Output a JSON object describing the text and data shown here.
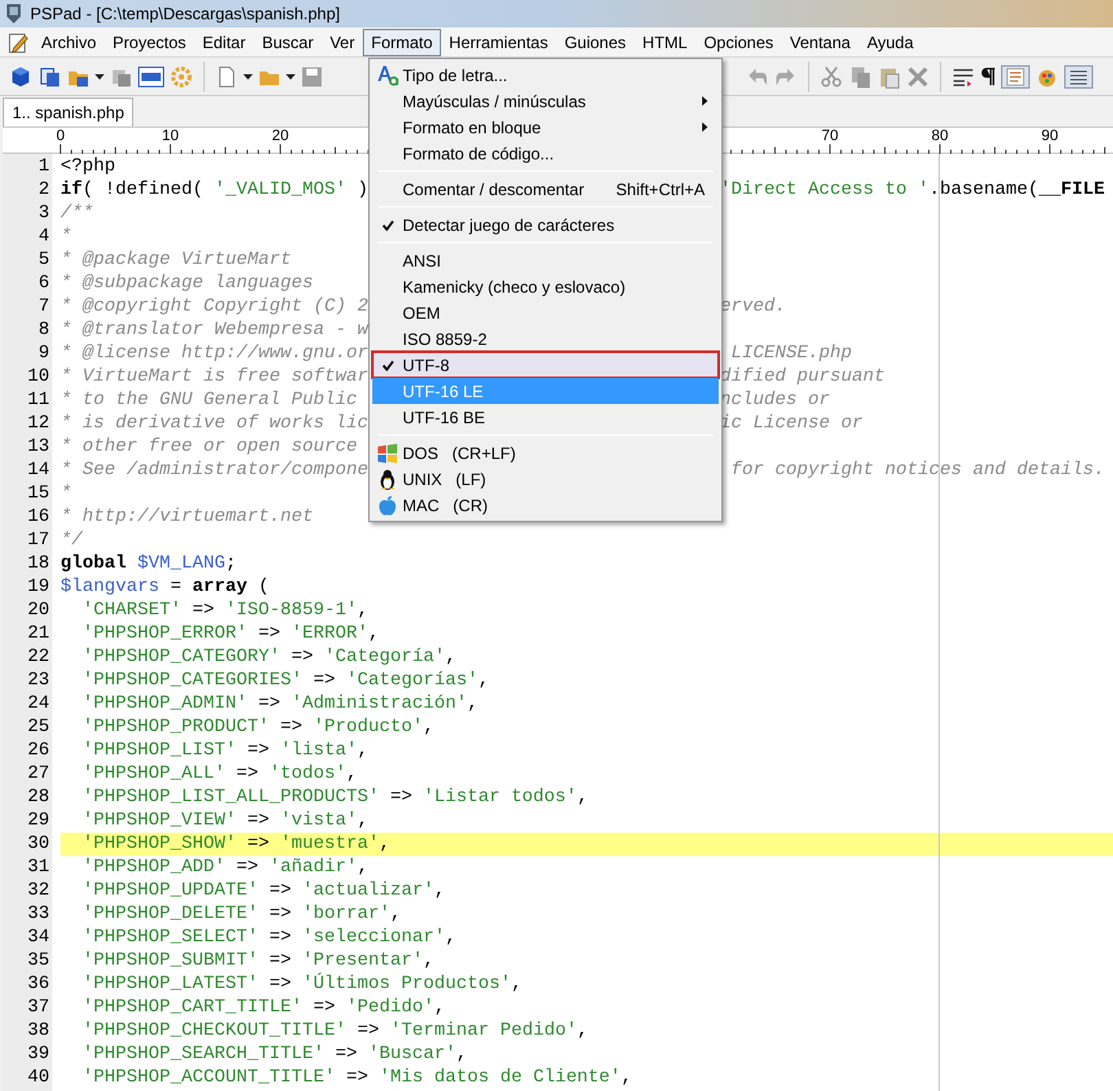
{
  "window": {
    "title": "PSPad - [C:\\temp\\Descargas\\spanish.php]"
  },
  "menu_bar": [
    {
      "label": "Archivo",
      "selected": false
    },
    {
      "label": "Proyectos",
      "selected": false
    },
    {
      "label": "Editar",
      "selected": false
    },
    {
      "label": "Buscar",
      "selected": false
    },
    {
      "label": "Ver",
      "selected": false
    },
    {
      "label": "Formato",
      "selected": true
    },
    {
      "label": "Herramientas",
      "selected": false
    },
    {
      "label": "Guiones",
      "selected": false
    },
    {
      "label": "HTML",
      "selected": false
    },
    {
      "label": "Opciones",
      "selected": false
    },
    {
      "label": "Ventana",
      "selected": false
    },
    {
      "label": "Ayuda",
      "selected": false
    }
  ],
  "tabs": [
    {
      "label": "1.. spanish.php",
      "selected": true
    }
  ],
  "ruler": [
    "0",
    "10",
    "20",
    "70",
    "80",
    "90"
  ],
  "editor": {
    "lines": [
      {
        "number": "1",
        "current": false,
        "tokens": [
          {
            "kind": "plain",
            "text": "<?php"
          }
        ]
      },
      {
        "number": "2",
        "current": false,
        "tokens": [
          {
            "kind": "keyword",
            "text": "if"
          },
          {
            "kind": "plain",
            "text": "( !defined( "
          },
          {
            "kind": "string",
            "text": "'_VALID_MOS'"
          },
          {
            "kind": "plain",
            "text": " )"
          }
        ],
        "tail": [
          {
            "kind": "string",
            "text": "'Direct Access to '"
          },
          {
            "kind": "plain",
            "text": ".basename("
          },
          {
            "kind": "keyword",
            "text": "__FILE"
          }
        ]
      },
      {
        "number": "3",
        "current": false,
        "tokens": [
          {
            "kind": "comment",
            "text": "/**"
          }
        ]
      },
      {
        "number": "4",
        "current": false,
        "tokens": [
          {
            "kind": "comment",
            "text": "*"
          }
        ]
      },
      {
        "number": "5",
        "current": false,
        "tokens": [
          {
            "kind": "comment",
            "text": "* @package VirtueMart"
          }
        ]
      },
      {
        "number": "6",
        "current": false,
        "tokens": [
          {
            "kind": "comment",
            "text": "* @subpackage languages"
          }
        ]
      },
      {
        "number": "7",
        "current": false,
        "tokens": [
          {
            "kind": "comment",
            "text": "* @copyright Copyright (C) 2"
          }
        ],
        "tail": [
          {
            "kind": "comment",
            "text": "erved."
          }
        ]
      },
      {
        "number": "8",
        "current": false,
        "tokens": [
          {
            "kind": "comment",
            "text": "* @translator Webempresa - w"
          }
        ]
      },
      {
        "number": "9",
        "current": false,
        "tokens": [
          {
            "kind": "comment",
            "text": "* @license http://www.gnu.or"
          }
        ],
        "tail": [
          {
            "kind": "comment",
            "text": " LICENSE.php"
          }
        ]
      },
      {
        "number": "10",
        "current": false,
        "tokens": [
          {
            "kind": "comment",
            "text": "* VirtueMart is free softwar"
          }
        ],
        "tail": [
          {
            "kind": "comment",
            "text": "dified pursuant"
          }
        ]
      },
      {
        "number": "11",
        "current": false,
        "tokens": [
          {
            "kind": "comment",
            "text": "* to the GNU General Public"
          }
        ],
        "tail": [
          {
            "kind": "comment",
            "text": "ncludes or"
          }
        ]
      },
      {
        "number": "12",
        "current": false,
        "tokens": [
          {
            "kind": "comment",
            "text": "* is derivative of works lic"
          }
        ],
        "tail": [
          {
            "kind": "comment",
            "text": "ic License or"
          }
        ]
      },
      {
        "number": "13",
        "current": false,
        "tokens": [
          {
            "kind": "comment",
            "text": "* other free or open source"
          }
        ]
      },
      {
        "number": "14",
        "current": false,
        "tokens": [
          {
            "kind": "comment",
            "text": "* See /administrator/compone"
          }
        ],
        "tail": [
          {
            "kind": "comment",
            "text": " for copyright notices and details."
          }
        ]
      },
      {
        "number": "15",
        "current": false,
        "tokens": [
          {
            "kind": "comment",
            "text": "*"
          }
        ]
      },
      {
        "number": "16",
        "current": false,
        "tokens": [
          {
            "kind": "comment",
            "text": "* http://virtuemart.net"
          }
        ]
      },
      {
        "number": "17",
        "current": false,
        "tokens": [
          {
            "kind": "comment",
            "text": "*/"
          }
        ]
      },
      {
        "number": "18",
        "current": false,
        "tokens": [
          {
            "kind": "keyword",
            "text": "global "
          },
          {
            "kind": "variable",
            "text": "$VM_LANG"
          },
          {
            "kind": "plain",
            "text": ";"
          }
        ]
      },
      {
        "number": "19",
        "current": false,
        "tokens": [
          {
            "kind": "variable",
            "text": "$langvars"
          },
          {
            "kind": "plain",
            "text": " = "
          },
          {
            "kind": "keyword",
            "text": "array"
          },
          {
            "kind": "plain",
            "text": " ("
          }
        ],
        "children": [
          {
            "number": "20",
            "current": false,
            "tokens": [
              {
                "kind": "string",
                "text": "'CHARSET'"
              },
              {
                "kind": "plain",
                "text": " => "
              },
              {
                "kind": "string",
                "text": "'ISO-8859-1'"
              },
              {
                "kind": "plain",
                "text": ","
              }
            ]
          },
          {
            "number": "21",
            "current": false,
            "tokens": [
              {
                "kind": "string",
                "text": "'PHPSHOP_ERROR'"
              },
              {
                "kind": "plain",
                "text": " => "
              },
              {
                "kind": "string",
                "text": "'ERROR'"
              },
              {
                "kind": "plain",
                "text": ","
              }
            ]
          },
          {
            "number": "22",
            "current": false,
            "tokens": [
              {
                "kind": "string",
                "text": "'PHPSHOP_CATEGORY'"
              },
              {
                "kind": "plain",
                "text": " => "
              },
              {
                "kind": "string",
                "text": "'Categoría'"
              },
              {
                "kind": "plain",
                "text": ","
              }
            ]
          },
          {
            "number": "23",
            "current": false,
            "tokens": [
              {
                "kind": "string",
                "text": "'PHPSHOP_CATEGORIES'"
              },
              {
                "kind": "plain",
                "text": " => "
              },
              {
                "kind": "string",
                "text": "'Categorías'"
              },
              {
                "kind": "plain",
                "text": ","
              }
            ]
          },
          {
            "number": "24",
            "current": false,
            "tokens": [
              {
                "kind": "string",
                "text": "'PHPSHOP_ADMIN'"
              },
              {
                "kind": "plain",
                "text": " => "
              },
              {
                "kind": "string",
                "text": "'Administración'"
              },
              {
                "kind": "plain",
                "text": ","
              }
            ]
          },
          {
            "number": "25",
            "current": false,
            "tokens": [
              {
                "kind": "string",
                "text": "'PHPSHOP_PRODUCT'"
              },
              {
                "kind": "plain",
                "text": " => "
              },
              {
                "kind": "string",
                "text": "'Producto'"
              },
              {
                "kind": "plain",
                "text": ","
              }
            ]
          },
          {
            "number": "26",
            "current": false,
            "tokens": [
              {
                "kind": "string",
                "text": "'PHPSHOP_LIST'"
              },
              {
                "kind": "plain",
                "text": " => "
              },
              {
                "kind": "string",
                "text": "'lista'"
              },
              {
                "kind": "plain",
                "text": ","
              }
            ]
          },
          {
            "number": "27",
            "current": false,
            "tokens": [
              {
                "kind": "string",
                "text": "'PHPSHOP_ALL'"
              },
              {
                "kind": "plain",
                "text": " => "
              },
              {
                "kind": "string",
                "text": "'todos'"
              },
              {
                "kind": "plain",
                "text": ","
              }
            ]
          },
          {
            "number": "28",
            "current": false,
            "tokens": [
              {
                "kind": "string",
                "text": "'PHPSHOP_LIST_ALL_PRODUCTS'"
              },
              {
                "kind": "plain",
                "text": " => "
              },
              {
                "kind": "string",
                "text": "'Listar todos'"
              },
              {
                "kind": "plain",
                "text": ","
              }
            ]
          },
          {
            "number": "29",
            "current": false,
            "tokens": [
              {
                "kind": "string",
                "text": "'PHPSHOP_VIEW'"
              },
              {
                "kind": "plain",
                "text": " => "
              },
              {
                "kind": "string",
                "text": "'vista'"
              },
              {
                "kind": "plain",
                "text": ","
              }
            ]
          },
          {
            "number": "30",
            "current": true,
            "tokens": [
              {
                "kind": "string",
                "text": "'PHPSHOP_SHOW'"
              },
              {
                "kind": "plain",
                "text": " => "
              },
              {
                "kind": "string",
                "text": "'muestra'"
              },
              {
                "kind": "plain",
                "text": ","
              }
            ]
          },
          {
            "number": "31",
            "current": false,
            "tokens": [
              {
                "kind": "string",
                "text": "'PHPSHOP_ADD'"
              },
              {
                "kind": "plain",
                "text": " => "
              },
              {
                "kind": "string",
                "text": "'añadir'"
              },
              {
                "kind": "plain",
                "text": ","
              }
            ]
          },
          {
            "number": "32",
            "current": false,
            "tokens": [
              {
                "kind": "string",
                "text": "'PHPSHOP_UPDATE'"
              },
              {
                "kind": "plain",
                "text": " => "
              },
              {
                "kind": "string",
                "text": "'actualizar'"
              },
              {
                "kind": "plain",
                "text": ","
              }
            ]
          },
          {
            "number": "33",
            "current": false,
            "tokens": [
              {
                "kind": "string",
                "text": "'PHPSHOP_DELETE'"
              },
              {
                "kind": "plain",
                "text": " => "
              },
              {
                "kind": "string",
                "text": "'borrar'"
              },
              {
                "kind": "plain",
                "text": ","
              }
            ]
          },
          {
            "number": "34",
            "current": false,
            "tokens": [
              {
                "kind": "string",
                "text": "'PHPSHOP_SELECT'"
              },
              {
                "kind": "plain",
                "text": " => "
              },
              {
                "kind": "string",
                "text": "'seleccionar'"
              },
              {
                "kind": "plain",
                "text": ","
              }
            ]
          },
          {
            "number": "35",
            "current": false,
            "tokens": [
              {
                "kind": "string",
                "text": "'PHPSHOP_SUBMIT'"
              },
              {
                "kind": "plain",
                "text": " => "
              },
              {
                "kind": "string",
                "text": "'Presentar'"
              },
              {
                "kind": "plain",
                "text": ","
              }
            ]
          },
          {
            "number": "36",
            "current": false,
            "tokens": [
              {
                "kind": "string",
                "text": "'PHPSHOP_LATEST'"
              },
              {
                "kind": "plain",
                "text": " => "
              },
              {
                "kind": "string",
                "text": "'Últimos Productos'"
              },
              {
                "kind": "plain",
                "text": ","
              }
            ]
          },
          {
            "number": "37",
            "current": false,
            "tokens": [
              {
                "kind": "string",
                "text": "'PHPSHOP_CART_TITLE'"
              },
              {
                "kind": "plain",
                "text": " => "
              },
              {
                "kind": "string",
                "text": "'Pedido'"
              },
              {
                "kind": "plain",
                "text": ","
              }
            ]
          },
          {
            "number": "38",
            "current": false,
            "tokens": [
              {
                "kind": "string",
                "text": "'PHPSHOP_CHECKOUT_TITLE'"
              },
              {
                "kind": "plain",
                "text": " => "
              },
              {
                "kind": "string",
                "text": "'Terminar Pedido'"
              },
              {
                "kind": "plain",
                "text": ","
              }
            ]
          },
          {
            "number": "39",
            "current": false,
            "tokens": [
              {
                "kind": "string",
                "text": "'PHPSHOP_SEARCH_TITLE'"
              },
              {
                "kind": "plain",
                "text": " => "
              },
              {
                "kind": "string",
                "text": "'Buscar'"
              },
              {
                "kind": "plain",
                "text": ","
              }
            ]
          },
          {
            "number": "40",
            "current": false,
            "tokens": [
              {
                "kind": "string",
                "text": "'PHPSHOP_ACCOUNT_TITLE'"
              },
              {
                "kind": "plain",
                "text": " => "
              },
              {
                "kind": "string",
                "text": "'Mis datos de Cliente'"
              },
              {
                "kind": "plain",
                "text": ","
              }
            ]
          }
        ]
      }
    ]
  },
  "dropdown": {
    "items": [
      {
        "kind": "font-item",
        "label": "Tipo de letra...",
        "submenu": false,
        "checked": false,
        "selected": false,
        "outlined": false
      },
      {
        "kind": "item",
        "label": "Mayúsculas / minúsculas",
        "submenu": true,
        "checked": false,
        "selected": false,
        "outlined": false
      },
      {
        "kind": "item",
        "label": "Formato en bloque",
        "submenu": true,
        "checked": false,
        "selected": false,
        "outlined": false
      },
      {
        "kind": "item",
        "label": "Formato de código...",
        "submenu": false,
        "checked": false,
        "selected": false,
        "outlined": false
      },
      {
        "kind": "separator"
      },
      {
        "kind": "item",
        "label": "Comentar / descomentar",
        "shortcut": "Shift+Ctrl+A",
        "submenu": false,
        "checked": false,
        "selected": false,
        "outlined": false
      },
      {
        "kind": "separator"
      },
      {
        "kind": "item",
        "label": "Detectar juego de carácteres",
        "submenu": false,
        "checked": true,
        "selected": false,
        "outlined": false
      },
      {
        "kind": "separator"
      },
      {
        "kind": "item",
        "label": "ANSI",
        "submenu": false,
        "checked": false,
        "selected": false,
        "outlined": false
      },
      {
        "kind": "item",
        "label": "Kamenicky (checo y eslovaco)",
        "submenu": false,
        "checked": false,
        "selected": false,
        "outlined": false
      },
      {
        "kind": "item",
        "label": "OEM",
        "submenu": false,
        "checked": false,
        "selected": false,
        "outlined": false
      },
      {
        "kind": "item",
        "label": "ISO 8859-2",
        "submenu": false,
        "checked": false,
        "selected": false,
        "outlined": false
      },
      {
        "kind": "item",
        "label": "UTF-8",
        "submenu": false,
        "checked": true,
        "selected": false,
        "outlined": true
      },
      {
        "kind": "item",
        "label": "UTF-16 LE",
        "submenu": false,
        "checked": false,
        "selected": true,
        "outlined": false
      },
      {
        "kind": "item",
        "label": "UTF-16 BE",
        "submenu": false,
        "checked": false,
        "selected": false,
        "outlined": false
      },
      {
        "kind": "separator"
      },
      {
        "kind": "line-ending",
        "label": "DOS",
        "note": "(CR+LF)",
        "submenu": false,
        "checked": false,
        "selected": false,
        "outlined": false
      },
      {
        "kind": "line-ending",
        "label": "UNIX",
        "note": "(LF)",
        "submenu": false,
        "checked": false,
        "selected": false,
        "outlined": false
      },
      {
        "kind": "line-ending",
        "label": "MAC",
        "note": "(CR)",
        "submenu": false,
        "checked": false,
        "selected": false,
        "outlined": false
      }
    ]
  }
}
